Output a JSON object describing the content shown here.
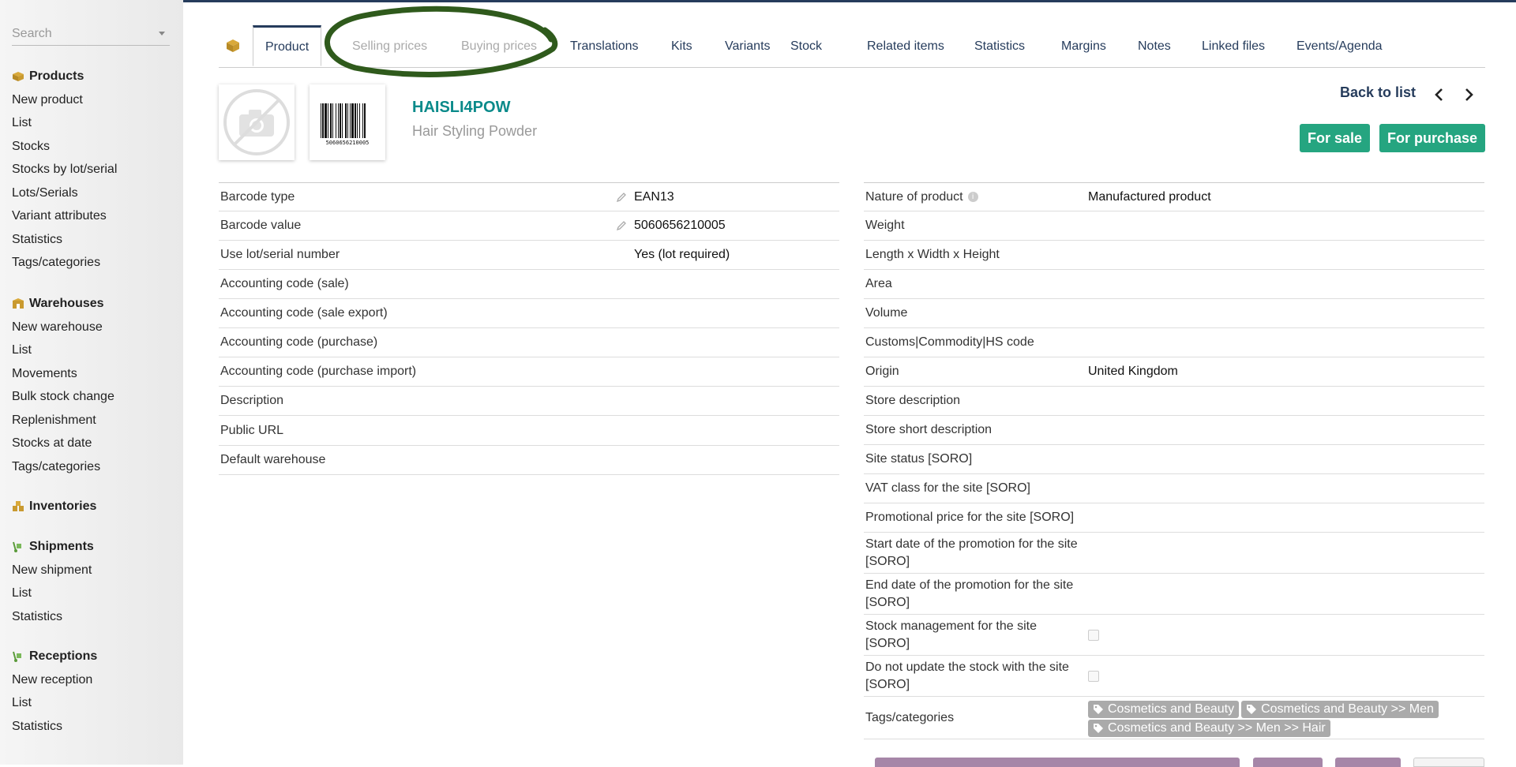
{
  "sidebar": {
    "search_placeholder": "Search",
    "sections": [
      {
        "title": "Products",
        "icon": "box-icon",
        "items": [
          "New product",
          "List",
          "Stocks",
          "Stocks by lot/serial",
          "Lots/Serials",
          "Variant attributes",
          "Statistics",
          "Tags/categories"
        ]
      },
      {
        "title": "Warehouses",
        "icon": "warehouse-icon",
        "items": [
          "New warehouse",
          "List",
          "Movements",
          "Bulk stock change",
          "Replenishment",
          "Stocks at date",
          "Tags/categories"
        ]
      },
      {
        "title": "Inventories",
        "icon": "inventory-icon",
        "items": []
      },
      {
        "title": "Shipments",
        "icon": "dolly-icon",
        "items": [
          "New shipment",
          "List",
          "Statistics"
        ]
      },
      {
        "title": "Receptions",
        "icon": "dolly-icon",
        "items": [
          "New reception",
          "List",
          "Statistics"
        ]
      }
    ]
  },
  "tabs": {
    "icon": "product-box-icon",
    "items": [
      {
        "label": "Product",
        "state": "active"
      },
      {
        "label": "Selling prices",
        "state": "disabled"
      },
      {
        "label": "Buying prices",
        "state": "disabled"
      },
      {
        "label": "Translations",
        "state": "normal"
      },
      {
        "label": "Kits",
        "state": "normal"
      },
      {
        "label": "Variants",
        "state": "normal"
      },
      {
        "label": "Stock",
        "state": "normal"
      },
      {
        "label": "Related items",
        "state": "normal"
      },
      {
        "label": "Statistics",
        "state": "normal"
      },
      {
        "label": "Margins",
        "state": "normal"
      },
      {
        "label": "Notes",
        "state": "normal"
      },
      {
        "label": "Linked files",
        "state": "normal"
      },
      {
        "label": "Events/Agenda",
        "state": "normal"
      }
    ],
    "annotation_color": "#2f5a1c"
  },
  "product": {
    "ref": "HAISLI4POW",
    "label": "Hair Styling Powder",
    "barcode_digits": "5060656210005",
    "back_label": "Back to list",
    "status_sale": "For sale",
    "status_purchase": "For purchase",
    "accent": "#25a580"
  },
  "left_fields": [
    {
      "label": "Barcode type",
      "value": "EAN13",
      "editable": true
    },
    {
      "label": "Barcode value",
      "value": "5060656210005",
      "editable": true
    },
    {
      "label": "Use lot/serial number",
      "value": "Yes (lot required)",
      "editable": false
    },
    {
      "label": "Accounting code (sale)",
      "value": "",
      "editable": false
    },
    {
      "label": "Accounting code (sale export)",
      "value": "",
      "editable": false
    },
    {
      "label": "Accounting code (purchase)",
      "value": "",
      "editable": false
    },
    {
      "label": "Accounting code (purchase import)",
      "value": "",
      "editable": false
    },
    {
      "label": "Description",
      "value": "",
      "editable": false
    },
    {
      "label": "Public URL",
      "value": "",
      "editable": false
    },
    {
      "label": "Default warehouse",
      "value": "",
      "editable": false
    }
  ],
  "right_fields": [
    {
      "label": "Nature of product",
      "value": "Manufactured product",
      "info": true
    },
    {
      "label": "Weight",
      "value": ""
    },
    {
      "label": "Length x Width x Height",
      "value": ""
    },
    {
      "label": "Area",
      "value": ""
    },
    {
      "label": "Volume",
      "value": ""
    },
    {
      "label": "Customs|Commodity|HS code",
      "value": ""
    },
    {
      "label": "Origin",
      "value": "United Kingdom"
    },
    {
      "label": "Store description",
      "value": ""
    },
    {
      "label": "Store short description",
      "value": ""
    },
    {
      "label": "Site status [SORO]",
      "value": ""
    },
    {
      "label": "VAT class for the site [SORO]",
      "value": ""
    },
    {
      "label": "Promotional price for the site [SORO]",
      "value": ""
    },
    {
      "label": "Start date of the promotion for the site [SORO]",
      "value": ""
    },
    {
      "label": "End date of the promotion for the site [SORO]",
      "value": ""
    },
    {
      "label": "Stock management for the site [SORO]",
      "value": "",
      "checkbox": true
    },
    {
      "label": "Do not update the stock with the site [SORO]",
      "value": "",
      "checkbox": true
    },
    {
      "label": "Tags/categories",
      "tags": [
        "Cosmetics and Beauty",
        "Cosmetics and Beauty >> Men",
        "Cosmetics and Beauty >> Men >> Hair"
      ]
    }
  ]
}
